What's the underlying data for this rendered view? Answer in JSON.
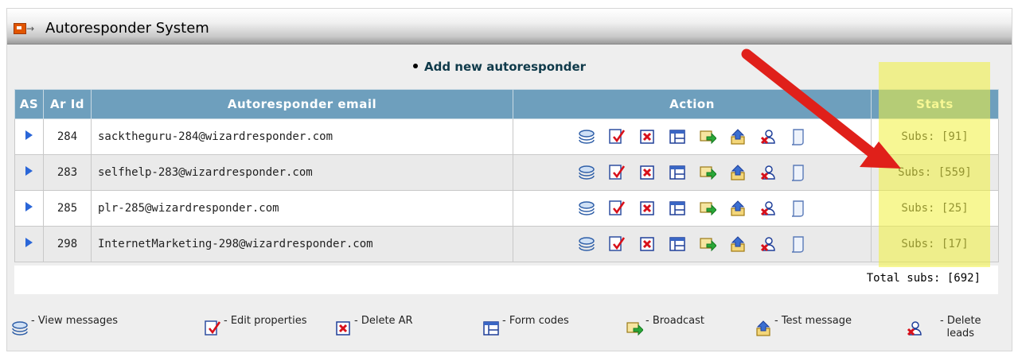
{
  "window": {
    "title": "Autoresponder System"
  },
  "add_link": {
    "label": "Add new autoresponder"
  },
  "table": {
    "headers": {
      "as": "AS",
      "ar_id": "Ar Id",
      "email": "Autoresponder email",
      "action": "Action",
      "stats": "Stats"
    },
    "rows": [
      {
        "ar_id": "284",
        "email": "sacktheguru-284@wizardresponder.com",
        "stats": "Subs: [91]"
      },
      {
        "ar_id": "283",
        "email": "selfhelp-283@wizardresponder.com",
        "stats": "Subs: [559]"
      },
      {
        "ar_id": "285",
        "email": "plr-285@wizardresponder.com",
        "stats": "Subs: [25]"
      },
      {
        "ar_id": "298",
        "email": "InternetMarketing-298@wizardresponder.com",
        "stats": "Subs: [17]"
      }
    ],
    "row_action_icons": [
      "view-messages-icon",
      "edit-properties-icon",
      "delete-ar-icon",
      "form-codes-icon",
      "broadcast-icon",
      "test-message-icon",
      "delete-leads-icon",
      "stats-sheet-icon"
    ]
  },
  "total": {
    "label": "Total subs: [692]"
  },
  "legend": {
    "view_messages": "- View messages",
    "edit_properties": "- Edit properties",
    "delete_ar": "- Delete AR",
    "form_codes": "- Form codes",
    "broadcast": "- Broadcast",
    "test_message": "- Test message",
    "delete_leads_1": "- Delete",
    "delete_leads_2": "leads"
  },
  "colors": {
    "header_bg": "#6e9fbd",
    "highlight": "#f0f03c",
    "annotation_arrow": "#e0201a"
  }
}
